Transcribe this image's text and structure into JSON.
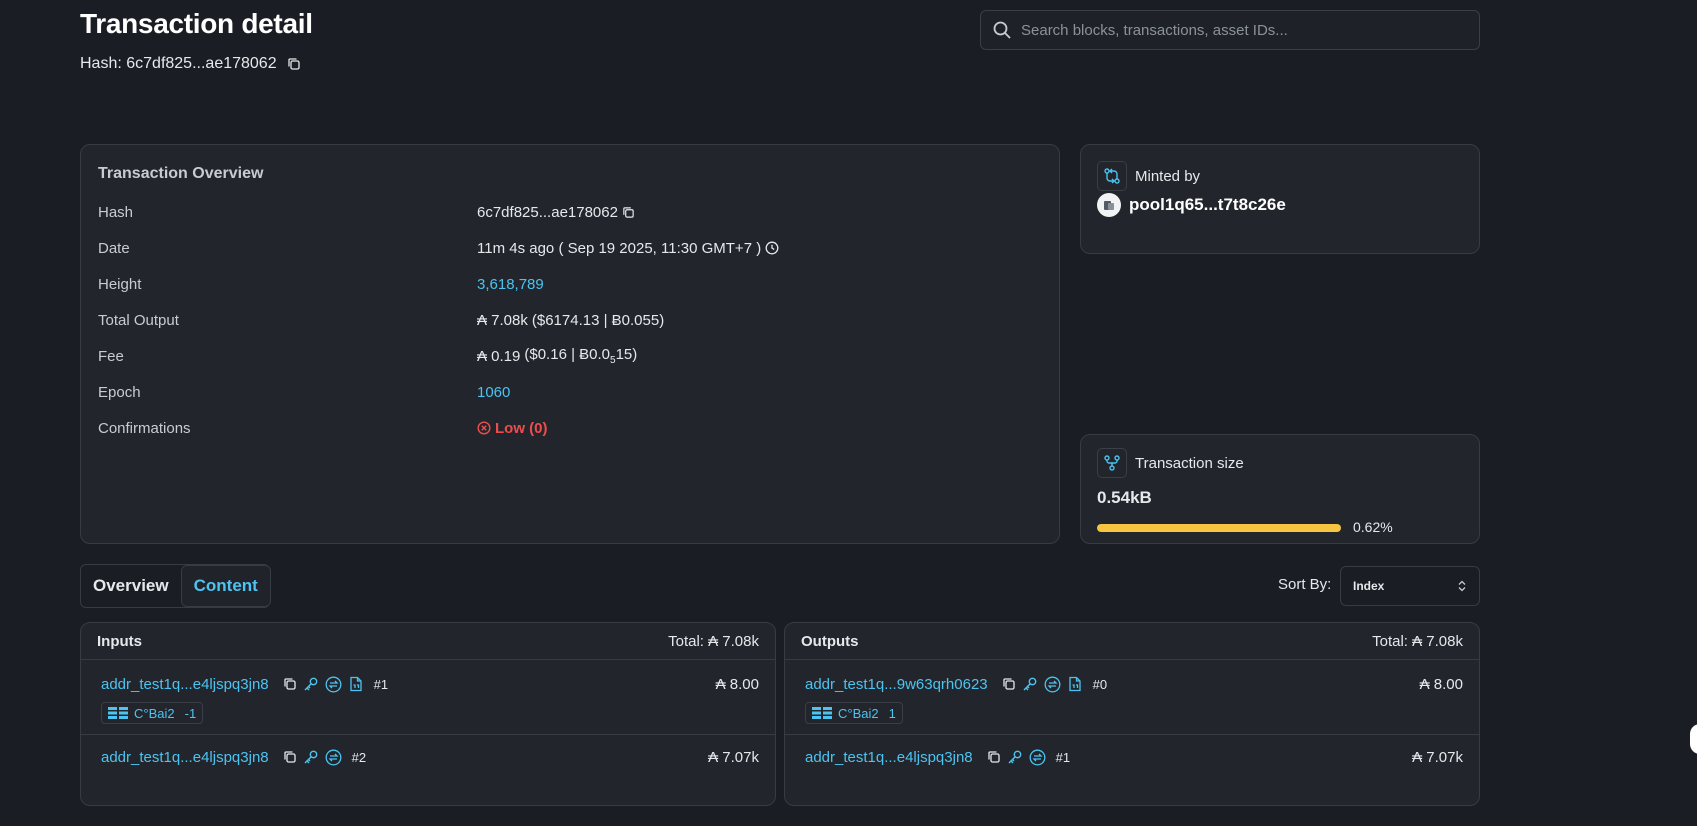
{
  "header": {
    "title": "Transaction detail",
    "hash_label": "Hash: 6c7df825...ae178062"
  },
  "search": {
    "placeholder": "Search blocks, transactions, asset IDs..."
  },
  "overview": {
    "title": "Transaction Overview",
    "rows": [
      {
        "label": "Hash",
        "value": "6c7df825...ae178062"
      },
      {
        "label": "Date",
        "value": "11m 4s ago ( Sep 19 2025, 11:30 GMT+7 )"
      },
      {
        "label": "Height",
        "value": "3,618,789"
      },
      {
        "label": "Total Output",
        "value": "₳ 7.08k",
        "extra": "($6174.13 | Ƀ0.055)"
      },
      {
        "label": "Fee",
        "value": "₳ 0.19",
        "extra_pre": "($0.16 | Ƀ0.0",
        "extra_sub": "5",
        "extra_post": "15)"
      },
      {
        "label": "Epoch",
        "value": "1060"
      },
      {
        "label": "Confirmations",
        "value": "Low (0)"
      }
    ]
  },
  "minted": {
    "label": "Minted by",
    "pool": "pool1q65...t7t8c26e"
  },
  "tx_size": {
    "label": "Transaction size",
    "value": "0.54kB",
    "percent_label": "0.62%",
    "percent": 0.0062
  },
  "tabs": [
    {
      "label": "Overview",
      "active": false
    },
    {
      "label": "Content",
      "active": true
    }
  ],
  "sort": {
    "label": "Sort By:",
    "value": "Index"
  },
  "inputs": {
    "title": "Inputs",
    "total": "Total: ₳ 7.08k",
    "rows": [
      {
        "address": "addr_test1q...e4ljspq3jn8",
        "index": "#1",
        "amount": "₳ 8.00",
        "token": {
          "name": "C°Bai2",
          "qty": "-1"
        }
      },
      {
        "address": "addr_test1q...e4ljspq3jn8",
        "index": "#2",
        "amount": "₳ 7.07k"
      }
    ]
  },
  "outputs": {
    "title": "Outputs",
    "total": "Total: ₳ 7.08k",
    "rows": [
      {
        "address": "addr_test1q...9w63qrh0623",
        "index": "#0",
        "amount": "₳ 8.00",
        "token": {
          "name": "C°Bai2",
          "qty": "1"
        }
      },
      {
        "address": "addr_test1q...e4ljspq3jn8",
        "index": "#1",
        "amount": "₳ 7.07k"
      }
    ]
  },
  "colors": {
    "accent": "#4cc3f0",
    "danger": "#ef4d4d",
    "progress": "#f5c542",
    "background": "#1a1d23"
  }
}
